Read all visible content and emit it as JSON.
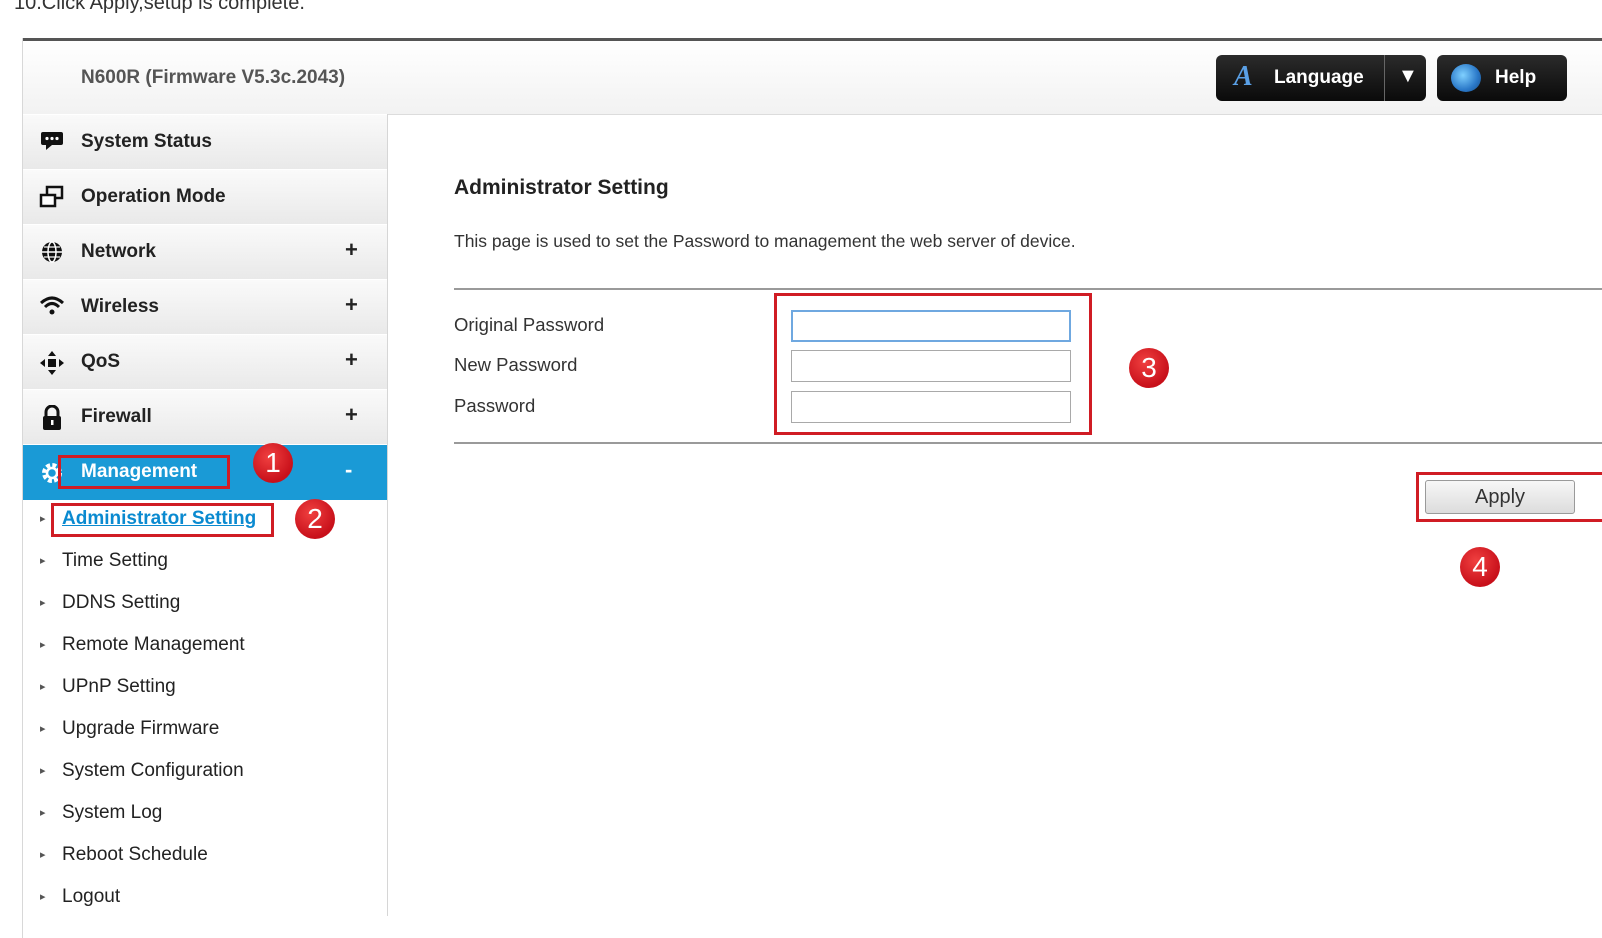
{
  "caption": "10.Click Apply,setup is complete.",
  "header": {
    "model": "N600R (Firmware V5.3c.2043)",
    "language_label": "Language",
    "language_glyph": "A",
    "help_label": "Help"
  },
  "sidebar": {
    "items": [
      {
        "label": "System Status",
        "icon": "chat-icon",
        "expand": ""
      },
      {
        "label": "Operation Mode",
        "icon": "operation-mode-icon",
        "expand": ""
      },
      {
        "label": "Network",
        "icon": "globe-icon",
        "expand": "+"
      },
      {
        "label": "Wireless",
        "icon": "wifi-icon",
        "expand": "+"
      },
      {
        "label": "QoS",
        "icon": "qos-icon",
        "expand": "+"
      },
      {
        "label": "Firewall",
        "icon": "lock-icon",
        "expand": "+"
      },
      {
        "label": "Management",
        "icon": "gear-icon",
        "expand": "-"
      }
    ],
    "subitems": [
      "Administrator Setting",
      "Time Setting",
      "DDNS Setting",
      "Remote Management",
      "UPnP Setting",
      "Upgrade Firmware",
      "System Configuration",
      "System Log",
      "Reboot Schedule",
      "Logout"
    ]
  },
  "main": {
    "title": "Administrator Setting",
    "description": "This page is used to set the Password to management the web server of device.",
    "fields": [
      {
        "label": "Original Password",
        "value": ""
      },
      {
        "label": "New Password",
        "value": ""
      },
      {
        "label": "Password",
        "value": ""
      }
    ],
    "apply_label": "Apply"
  },
  "annotations": {
    "steps": [
      "1",
      "2",
      "3",
      "4"
    ],
    "highlight_color": "#d01c24"
  },
  "colors": {
    "accent": "#1a9ad6",
    "link": "#0a8ad0"
  }
}
